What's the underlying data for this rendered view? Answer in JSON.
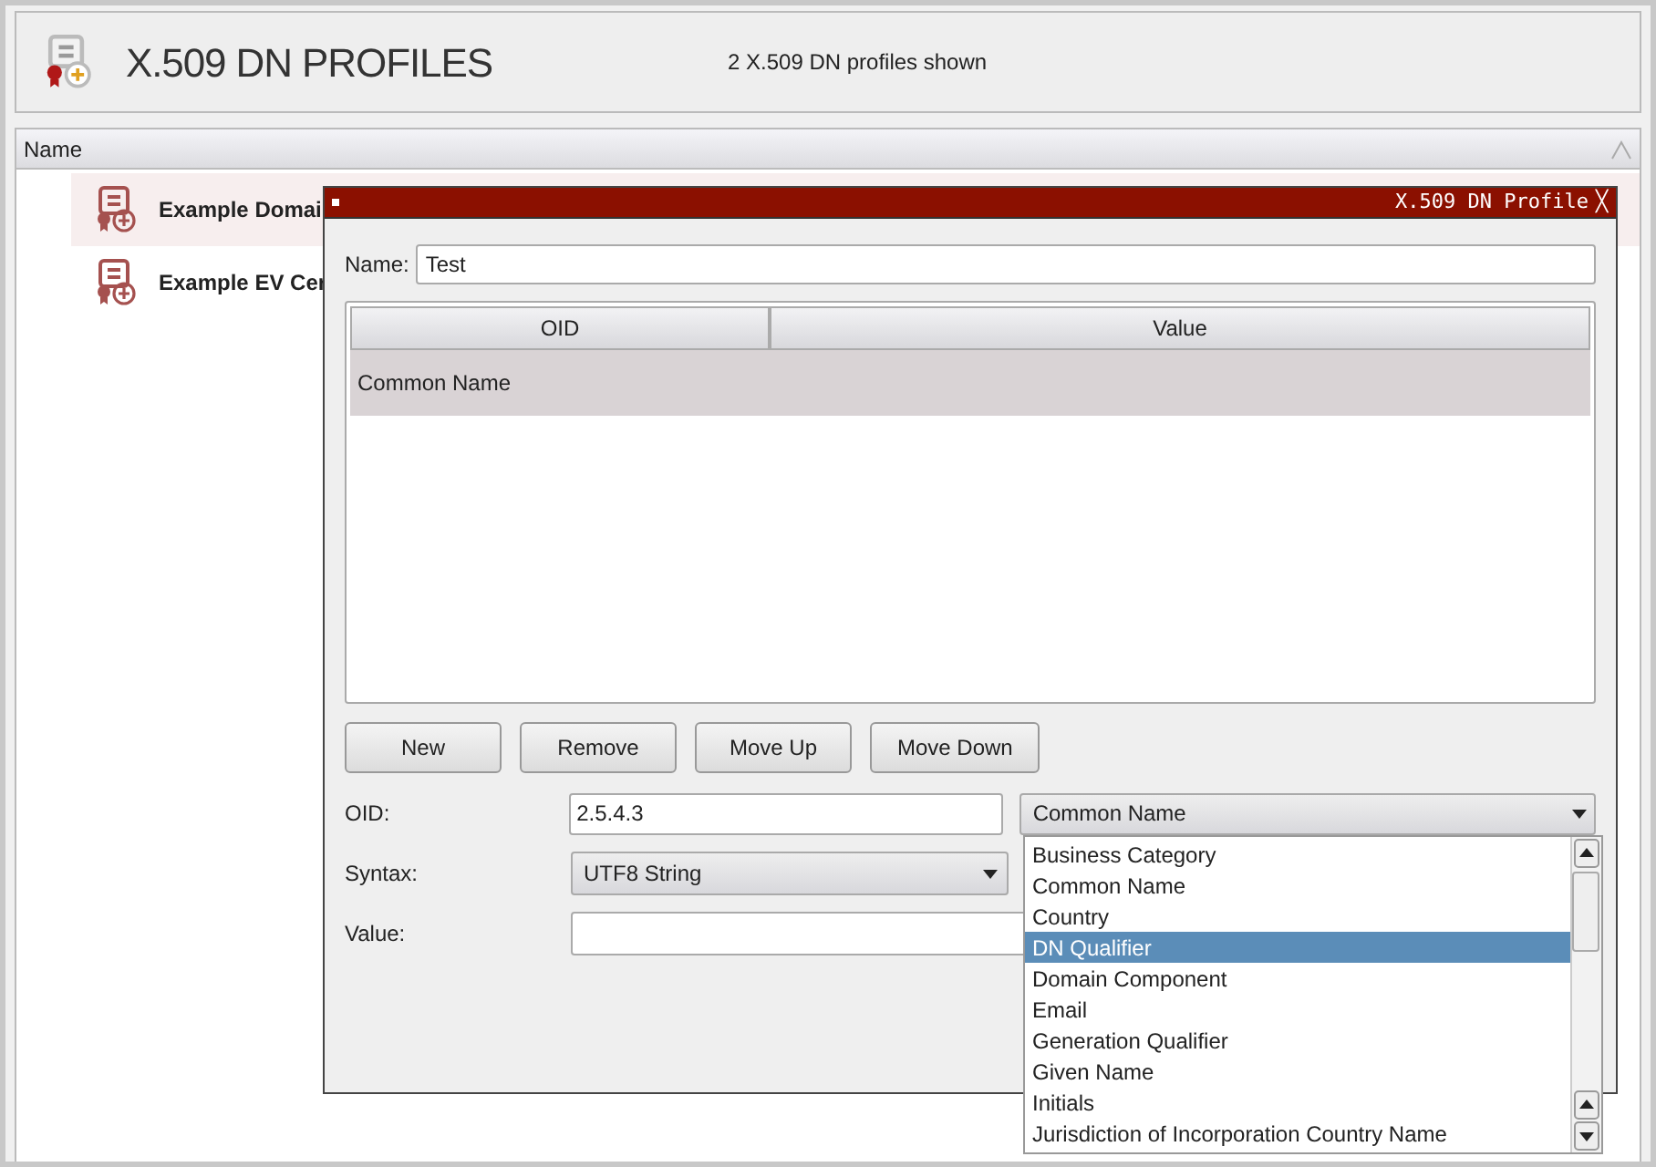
{
  "header": {
    "title": "X.509 DN PROFILES",
    "count": "2 X.509 DN profiles shown"
  },
  "table": {
    "columns": [
      {
        "label": "Name",
        "sorted_ascending": true
      }
    ],
    "rows": [
      {
        "name": "Example Domai",
        "selected": true
      },
      {
        "name": "Example EV Cer",
        "selected": false
      }
    ]
  },
  "dialog": {
    "title": "X.509 DN Profile",
    "close": "╳",
    "name_label": "Name:",
    "name_value": "Test",
    "columns": [
      "OID",
      "Value"
    ],
    "rows": [
      {
        "oid": "Common Name",
        "selected": true
      }
    ],
    "buttons": [
      "New",
      "Remove",
      "Move Up",
      "Move Down"
    ],
    "oid_label": "OID:",
    "oid_value": "2.5.4.3",
    "oid_choice": "Common Name",
    "syntax_label": "Syntax:",
    "syntax_value": "UTF8 String",
    "value_label": "Value:"
  },
  "dropdown": {
    "items": [
      {
        "label": "Business Category",
        "selected": false
      },
      {
        "label": "Common Name",
        "selected": false
      },
      {
        "label": "Country",
        "selected": false
      },
      {
        "label": "DN Qualifier",
        "selected": true
      },
      {
        "label": "Domain Component",
        "selected": false
      },
      {
        "label": "Email",
        "selected": false
      },
      {
        "label": "Generation Qualifier",
        "selected": false
      },
      {
        "label": "Given Name",
        "selected": false
      },
      {
        "label": "Initials",
        "selected": false
      },
      {
        "label": "Jurisdiction of Incorporation Country Name",
        "selected": false
      }
    ]
  }
}
